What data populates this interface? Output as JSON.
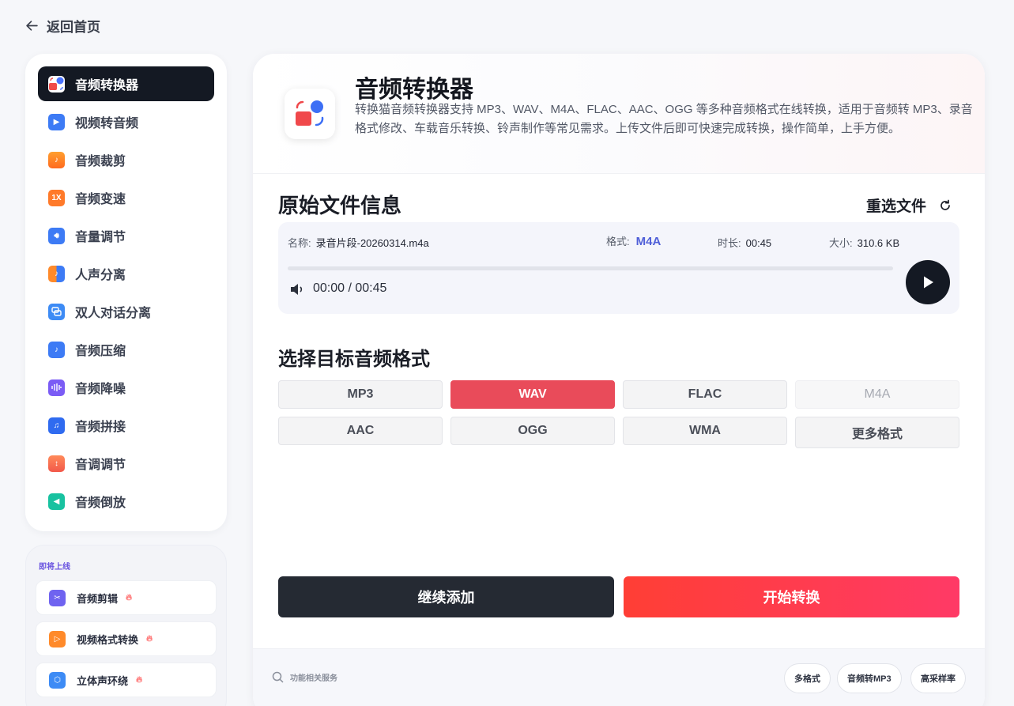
{
  "back": {
    "label": "返回首页"
  },
  "sidebar": {
    "items": [
      {
        "label": "音频转换器",
        "icon": "convert-icon",
        "active": true
      },
      {
        "label": "视频转音频",
        "icon": "video-audio-icon"
      },
      {
        "label": "音频裁剪",
        "icon": "crop-icon"
      },
      {
        "label": "音频变速",
        "icon": "speed-icon",
        "glyph": "1X"
      },
      {
        "label": "音量调节",
        "icon": "volume-icon"
      },
      {
        "label": "人声分离",
        "icon": "vocal-split-icon"
      },
      {
        "label": "双人对话分离",
        "icon": "dialog-icon"
      },
      {
        "label": "音频压缩",
        "icon": "compress-icon"
      },
      {
        "label": "音频降噪",
        "icon": "denoise-icon"
      },
      {
        "label": "音频拼接",
        "icon": "merge-icon"
      },
      {
        "label": "音调调节",
        "icon": "pitch-icon"
      },
      {
        "label": "音频倒放",
        "icon": "reverse-icon"
      }
    ]
  },
  "coming_soon": {
    "title": "即将上线",
    "items": [
      {
        "label": "音频剪辑",
        "icon": "scissors-icon"
      },
      {
        "label": "视频格式转换",
        "icon": "video-convert-icon"
      },
      {
        "label": "立体声环绕",
        "icon": "cube-icon"
      }
    ]
  },
  "header": {
    "title": "音频转换器",
    "description": "转换猫音频转换器支持 MP3、WAV、M4A、FLAC、AAC、OGG 等多种音频格式在线转换，适用于音频转 MP3、录音格式修改、车载音乐转换、铃声制作等常见需求。上传文件后即可快速完成转换，操作简单，上手方便。"
  },
  "file_info": {
    "section_title": "原始文件信息",
    "reselect_label": "重选文件",
    "name_label": "名称:",
    "name_value": "录音片段-20260314.m4a",
    "format_label": "格式:",
    "format_value": "M4A",
    "duration_label": "时长:",
    "duration_value": "00:45",
    "size_label": "大小:",
    "size_value": "310.6 KB",
    "player_time": "00:00 / 00:45",
    "progress": 0
  },
  "target_format": {
    "section_title": "选择目标音频格式",
    "options": [
      {
        "label": "MP3",
        "state": "normal"
      },
      {
        "label": "WAV",
        "state": "selected"
      },
      {
        "label": "FLAC",
        "state": "normal"
      },
      {
        "label": "M4A",
        "state": "disabled"
      },
      {
        "label": "AAC",
        "state": "normal"
      },
      {
        "label": "OGG",
        "state": "normal"
      },
      {
        "label": "WMA",
        "state": "normal"
      },
      {
        "label": "更多格式",
        "state": "more"
      }
    ]
  },
  "actions": {
    "continue_label": "继续添加",
    "start_label": "开始转换"
  },
  "footer": {
    "search_label": "功能相关服务",
    "chips": [
      "多格式",
      "音频转MP3",
      "高采样率"
    ]
  },
  "colors": {
    "accent": "#e94b5a",
    "dark": "#141923",
    "format_highlight": "#4f5fd8"
  }
}
